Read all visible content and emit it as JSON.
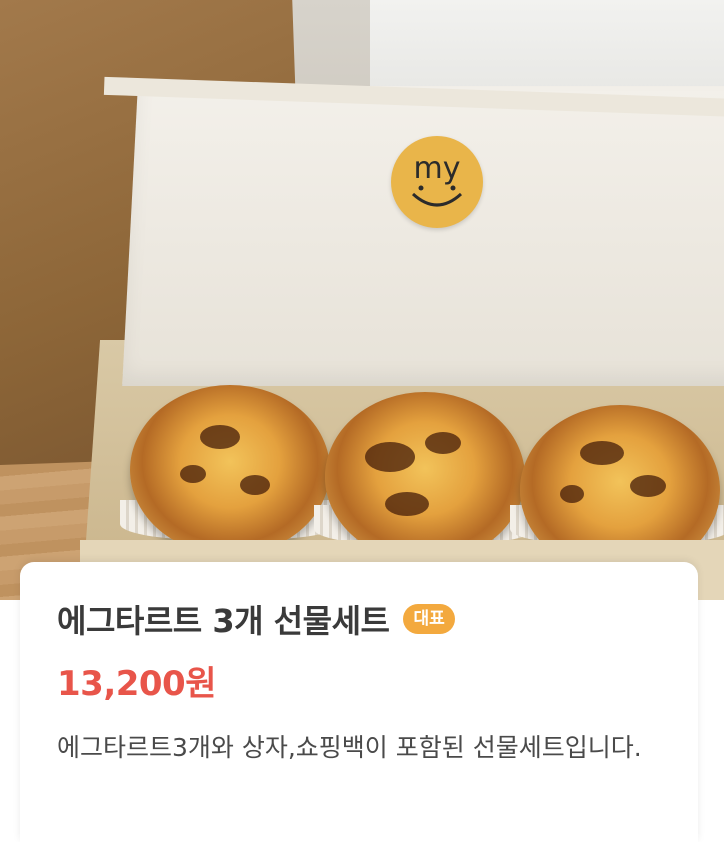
{
  "product": {
    "title": "에그타르트 3개 선물세트",
    "badge": "대표",
    "price": "13,200원",
    "description": "에그타르트3개와 상자,쇼핑백이 포함된 선물세트입니다."
  },
  "photo": {
    "sticker_text": "my",
    "sticker_color": "#e9b54a"
  },
  "colors": {
    "price": "#e8554a",
    "badge": "#f3a93e",
    "title": "#3a3a3a"
  }
}
